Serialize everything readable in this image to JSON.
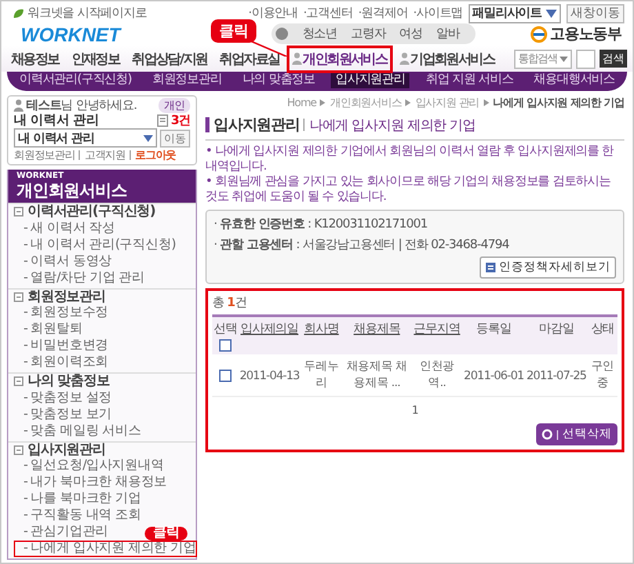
{
  "top_bar": {
    "start_page_link": "워크넷을 시작페이지로",
    "links": [
      "·이용안내",
      "·고객센터",
      "·원격제어",
      "·사이트맵"
    ],
    "family_site": "패밀리사이트",
    "go_button": "새창이동"
  },
  "logo": "WORKNET",
  "audience_tabs": [
    "청소년",
    "고령자",
    "여성",
    "알바"
  ],
  "ministry": "고용노동부",
  "main_nav": [
    {
      "label": "채용정보",
      "selected": false,
      "highlighted": false
    },
    {
      "label": "인재정보",
      "selected": false,
      "highlighted": false
    },
    {
      "label": "취업상담/지원",
      "selected": false,
      "highlighted": false
    },
    {
      "label": "취업자료실",
      "selected": false,
      "highlighted": false
    },
    {
      "label": "개인회원서비스",
      "selected": true,
      "highlighted": true,
      "callout": "클릭"
    },
    {
      "label": "기업회원서비스",
      "selected": false,
      "highlighted": false
    }
  ],
  "search": {
    "scope": "통합검색",
    "button": "검색"
  },
  "sub_nav": [
    {
      "label": "이력서관리(구직신청)",
      "selected": false
    },
    {
      "label": "회원정보관리",
      "selected": false
    },
    {
      "label": "나의 맞춤정보",
      "selected": false
    },
    {
      "label": "입사지원관리",
      "selected": true
    },
    {
      "label": "취업 지원 서비스",
      "selected": false
    },
    {
      "label": "채용대행서비스",
      "selected": false
    }
  ],
  "login_box": {
    "greeting": "**테스트**님 안녕하세요.",
    "badge": "개인",
    "resume_label": "내 이력서 관리",
    "resume_count": "3건",
    "resume_select": "내 이력서 관리",
    "move_button": "이동",
    "links": [
      "회원정보관리",
      "고객지원",
      "로그아웃"
    ]
  },
  "sidebar": {
    "brand": "WORKNET",
    "title": "개인회원서비스",
    "sections": [
      {
        "title": "이력서관리(구직신청)",
        "items": [
          {
            "label": "- 새 이력서 작성",
            "highlighted": false
          },
          {
            "label": "- 내 이력서 관리(구직신청)",
            "highlighted": false
          },
          {
            "label": "- 이력서 동영상",
            "highlighted": false
          },
          {
            "label": "- 열람/차단 기업 관리",
            "highlighted": false
          }
        ]
      },
      {
        "title": "회원정보관리",
        "items": [
          {
            "label": "- 회원정보수정",
            "highlighted": false
          },
          {
            "label": "- 회원탈퇴",
            "highlighted": false
          },
          {
            "label": "- 비밀번호변경",
            "highlighted": false
          },
          {
            "label": "- 회원이력조회",
            "highlighted": false
          }
        ]
      },
      {
        "title": "나의 맞춤정보",
        "items": [
          {
            "label": "- 맞춤정보 설정",
            "highlighted": false
          },
          {
            "label": "- 맞춤정보 보기",
            "highlighted": false
          },
          {
            "label": "- 맞춤 메일링 서비스",
            "highlighted": false
          }
        ]
      },
      {
        "title": "입사지원관리",
        "items": [
          {
            "label": "- 일선요청/입사지원내역",
            "highlighted": false
          },
          {
            "label": "- 내가 북마크한 채용정보",
            "highlighted": false
          },
          {
            "label": "- 나를 북마크한 기업",
            "highlighted": false
          },
          {
            "label": "- 구직활동 내역 조회",
            "highlighted": false
          },
          {
            "label": "- 관심기업관리",
            "highlighted": false
          },
          {
            "label": "- 나에게 입사지원 제의한 기업",
            "highlighted": true,
            "callout": "클릭"
          }
        ]
      }
    ]
  },
  "breadcrumb": [
    "Home",
    "개인회원서비스",
    "입사지원 관리",
    "나에게 입사지원 제의한 기업"
  ],
  "page_title": {
    "section": "입사지원관리",
    "subtitle": "나에게 입사지원 제의한 기업"
  },
  "notes": [
    "• 나에게 입사지원 제의한 기업에서 회원님의 이력서 열람 후 입사지원제의를 한 내역입니다.",
    "• 회원님께 관심을 가지고 있는 회사이므로 해당 기업의 채용정보를 검토하시는 것도 취업에 도움이 될 수 있습니다."
  ],
  "info_box": {
    "rows": [
      "· **유효한 인증번호** : K120031102171001",
      "· **관할 고용센터** : 서울강남고용센터 | 전화 02-3468-4794"
    ],
    "button": "인증정책자세히보기"
  },
  "results": {
    "highlighted": true,
    "total": "총 **1**건",
    "columns": [
      {
        "label": "선택",
        "sortable": false
      },
      {
        "label": "입사제의일",
        "sortable": true
      },
      {
        "label": "회사명",
        "sortable": true
      },
      {
        "label": "채용제목",
        "sortable": true
      },
      {
        "label": "근무지역",
        "sortable": true
      },
      {
        "label": "등록일",
        "sortable": false
      },
      {
        "label": "마감일",
        "sortable": false
      },
      {
        "label": "상태",
        "sortable": false
      }
    ],
    "header_checked": false,
    "rows": [
      {
        "checked": false,
        "cells": [
          "",
          "2011-04-13",
          "두레누리",
          "채용제목 채용제목 ...",
          "인천광역..",
          "2011-06-01",
          "2011-07-25",
          "구인중"
        ]
      }
    ],
    "pages": [
      "1"
    ],
    "delete_button": "선택삭제"
  }
}
